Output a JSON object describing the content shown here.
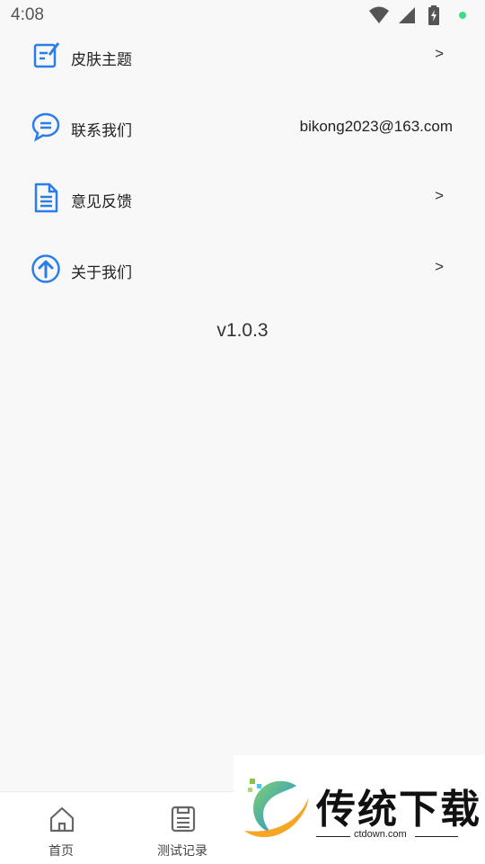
{
  "status_bar": {
    "time": "4:08",
    "icons": [
      "wifi-icon",
      "signal-icon",
      "battery-charging-icon",
      "notification-dot"
    ],
    "dot_color": "#3ddc84"
  },
  "menu": {
    "items": [
      {
        "label": "皮肤主题",
        "icon": "edit-note-icon",
        "value": "",
        "arrow": ">"
      },
      {
        "label": "联系我们",
        "icon": "chat-bubble-icon",
        "value": "bikong2023@163.com",
        "arrow": ""
      },
      {
        "label": "意见反馈",
        "icon": "document-icon",
        "value": "",
        "arrow": ">"
      },
      {
        "label": "关于我们",
        "icon": "arrow-up-circle-icon",
        "value": "",
        "arrow": ">"
      }
    ]
  },
  "version": "v1.0.3",
  "bottom_nav": {
    "tabs": [
      {
        "label": "首页",
        "icon": "home-icon"
      },
      {
        "label": "测试记录",
        "icon": "record-icon"
      }
    ]
  },
  "watermark": {
    "title": "传统下载",
    "subtitle": "ctdown.com"
  },
  "colors": {
    "accent": "#2b7de9",
    "background": "#f8f8f8"
  }
}
